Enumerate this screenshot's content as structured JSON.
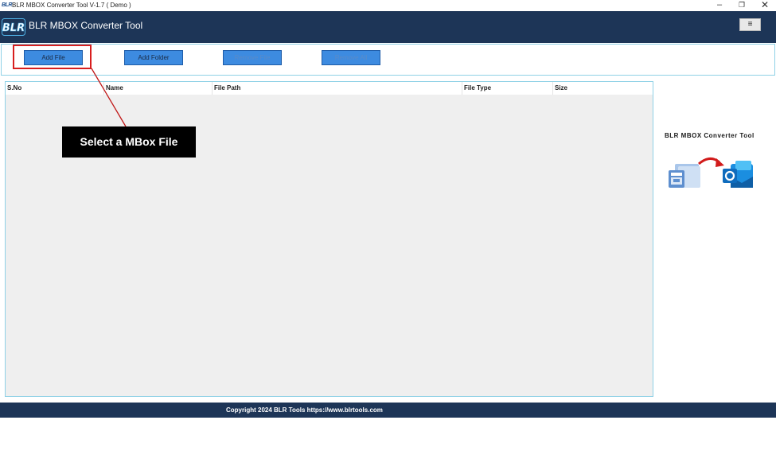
{
  "window": {
    "logo_text": "BLR",
    "title": "BLR MBOX Converter Tool V-1.7 ( Demo )",
    "minimize_glyph": "–",
    "restore_glyph": "❐",
    "close_glyph": "✕"
  },
  "header": {
    "logo_text": "BLR",
    "title": "BLR MBOX Converter Tool",
    "menu_glyph": "≡"
  },
  "toolbar": {
    "add_file": "Add File",
    "add_folder": "Add Folder",
    "remove_file": "Remove File",
    "remove_all": "Remove All"
  },
  "table": {
    "columns": [
      "S.No",
      "Name",
      "File Path",
      "File Type",
      "Size"
    ],
    "rows": []
  },
  "callout": {
    "text": "Select a MBox File"
  },
  "side": {
    "title": "BLR MBOX Converter Tool"
  },
  "footer": {
    "text": "Copyright 2024 BLR Tools https://www.blrtools.com"
  },
  "colors": {
    "header_bg": "#1d3557",
    "button_bg": "#3d8be0",
    "panel_border": "#8fd1e6",
    "highlight": "#d81e1e",
    "outlook_blue": "#0f6cbd"
  },
  "icons": [
    "app-logo-icon",
    "menu-icon",
    "mbox-folder-icon",
    "convert-arrow-icon",
    "outlook-icon"
  ]
}
